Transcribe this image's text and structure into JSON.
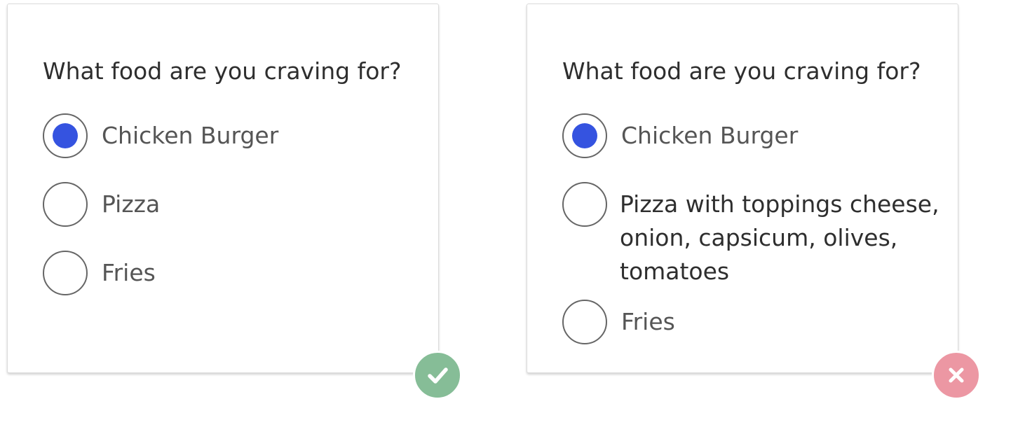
{
  "examples": [
    {
      "id": "good",
      "question": "What food are you craving for?",
      "options": [
        {
          "label": "Chicken Burger",
          "checked": true
        },
        {
          "label": "Pizza",
          "checked": false
        },
        {
          "label": "Fries",
          "checked": false
        }
      ],
      "badge": {
        "icon": "checkmark-icon",
        "color": "#86bd97"
      }
    },
    {
      "id": "bad",
      "question": "What food are you craving for?",
      "options": [
        {
          "label": "Chicken Burger",
          "checked": true
        },
        {
          "label": "Pizza with toppings cheese, onion, capsicum, olives, tomatoes",
          "checked": false
        },
        {
          "label": "Fries",
          "checked": false
        }
      ],
      "badge": {
        "icon": "close-x-icon",
        "color": "#ec97a3"
      }
    }
  ],
  "colors": {
    "radio_selected": "#3553e0",
    "radio_border": "#666666",
    "text_dark": "#2e2e2e",
    "text_option": "#555555"
  }
}
